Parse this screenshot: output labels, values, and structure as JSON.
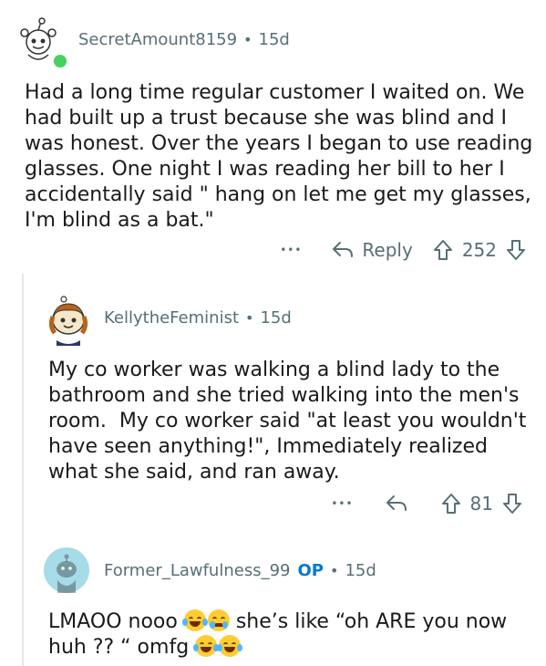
{
  "comments": [
    {
      "username": "SecretAmount8159",
      "age": "15d",
      "body": "Had a long time regular customer I waited on. We\nhad built up a trust because she was blind and I\nwas honest. Over the years I began to use reading\nglasses. One night I was reading her bill to her I\naccidentally said \" hang on let me get my glasses,\nI'm blind as a bat.\"",
      "more": "•••",
      "reply_label": "Reply",
      "votes": "252"
    },
    {
      "username": "KellytheFeminist",
      "age": "15d",
      "body": "My co worker was walking a blind lady to the\nbathroom and she tried walking into the men's\nroom.  My co worker said \"at least you wouldn't\nhave seen anything!\", Immediately realized\nwhat she said, and ran away.",
      "more": "•••",
      "votes": "81"
    },
    {
      "username": "Former_Lawfulness_99",
      "op_badge": "OP",
      "age": "15d",
      "body_part1": "LMAOO nooo ",
      "body_part2": " she’s like “oh ARE you now",
      "body_part3": "huh ?? “ omfg "
    }
  ],
  "separator": "•",
  "colors": {
    "meta": "#576f76",
    "op": "#0079d3",
    "online": "#46d160"
  }
}
